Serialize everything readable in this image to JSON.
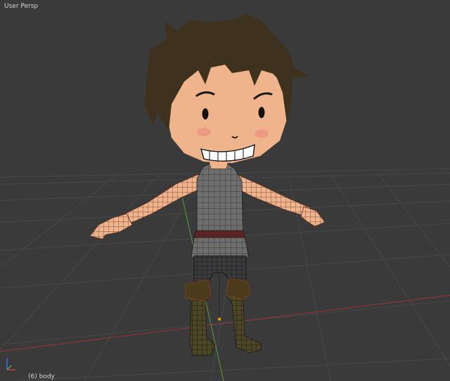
{
  "viewport": {
    "view_name": "User Persp",
    "object_name": "(6) body"
  },
  "colors": {
    "background": "#3a3a3a",
    "grid": "#484848",
    "x_axis": "#8a3636",
    "y_axis": "#5a8a3a",
    "skin": "#f0b48c",
    "hair": "#3e321e",
    "shirt": "#6e6e6e",
    "pants": "#3a3a3a",
    "boots": "#4a4424",
    "belt": "#5a2424",
    "wire": "#1a1a1a",
    "origin": "#e0a000"
  }
}
